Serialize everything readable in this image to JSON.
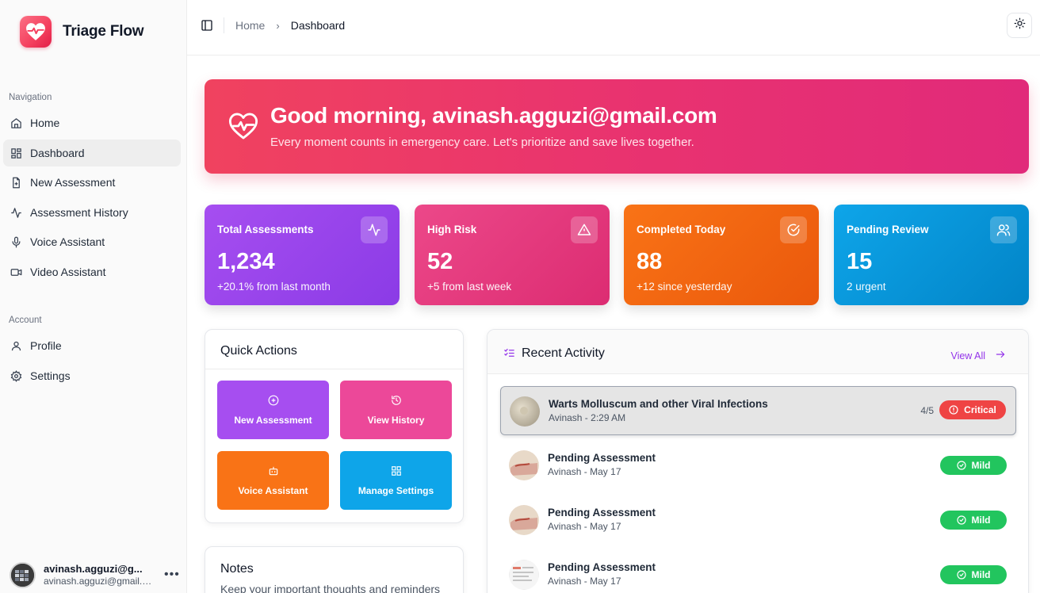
{
  "app": {
    "name": "Triage Flow"
  },
  "sidebar": {
    "nav_label": "Navigation",
    "nav_items": [
      {
        "label": "Home",
        "icon": "home-icon"
      },
      {
        "label": "Dashboard",
        "icon": "dashboard-icon",
        "active": true
      },
      {
        "label": "New Assessment",
        "icon": "file-plus-icon"
      },
      {
        "label": "Assessment History",
        "icon": "activity-icon"
      },
      {
        "label": "Voice Assistant",
        "icon": "mic-icon"
      },
      {
        "label": "Video Assistant",
        "icon": "video-icon"
      }
    ],
    "account_label": "Account",
    "account_items": [
      {
        "label": "Profile",
        "icon": "user-icon"
      },
      {
        "label": "Settings",
        "icon": "gear-icon"
      }
    ],
    "user": {
      "name": "avinash.agguzi@g...",
      "email": "avinash.agguzi@gmail.c...",
      "more": "•••"
    }
  },
  "topbar": {
    "breadcrumb": {
      "home": "Home",
      "separator": "›",
      "current": "Dashboard"
    }
  },
  "hero": {
    "title": "Good morning, avinash.agguzi@gmail.com",
    "subtitle": "Every moment counts in emergency care. Let's prioritize and save lives together."
  },
  "stats": [
    {
      "label": "Total Assessments",
      "value": "1,234",
      "note": "+20.1% from last month",
      "icon": "activity-icon",
      "color": "#9b45ec"
    },
    {
      "label": "High Risk",
      "value": "52",
      "note": "+5 from last week",
      "icon": "alert-triangle-icon",
      "color": "#e6337a"
    },
    {
      "label": "Completed Today",
      "value": "88",
      "note": "+12 since yesterday",
      "icon": "check-circle-icon",
      "color": "#f26411"
    },
    {
      "label": "Pending Review",
      "value": "15",
      "note": "2 urgent",
      "icon": "users-icon",
      "color": "#0b94d8"
    }
  ],
  "quick_actions": {
    "title": "Quick Actions",
    "buttons": [
      {
        "label": "New Assessment",
        "icon": "plus-circle-icon",
        "color": "#a64ef0"
      },
      {
        "label": "View History",
        "icon": "history-icon",
        "color": "#ec4899"
      },
      {
        "label": "Voice Assistant",
        "icon": "bot-icon",
        "color": "#f97316"
      },
      {
        "label": "Manage Settings",
        "icon": "grid-icon",
        "color": "#0ea5e9"
      }
    ]
  },
  "notes": {
    "title": "Notes",
    "subtitle": "Keep your important thoughts and reminders"
  },
  "recent_activity": {
    "title": "Recent Activity",
    "view_all": "View All",
    "items": [
      {
        "title": "Warts Molluscum and other Viral Infections",
        "sub": "Avinash - 2:29 AM",
        "score": "4/5",
        "badge": "Critical",
        "severity": "critical",
        "selected": true
      },
      {
        "title": "Pending Assessment",
        "sub": "Avinash - May 17",
        "score": "",
        "badge": "Mild",
        "severity": "mild"
      },
      {
        "title": "Pending Assessment",
        "sub": "Avinash - May 17",
        "score": "",
        "badge": "Mild",
        "severity": "mild"
      },
      {
        "title": "Pending Assessment",
        "sub": "Avinash - May 17",
        "score": "",
        "badge": "Mild",
        "severity": "mild"
      }
    ]
  }
}
